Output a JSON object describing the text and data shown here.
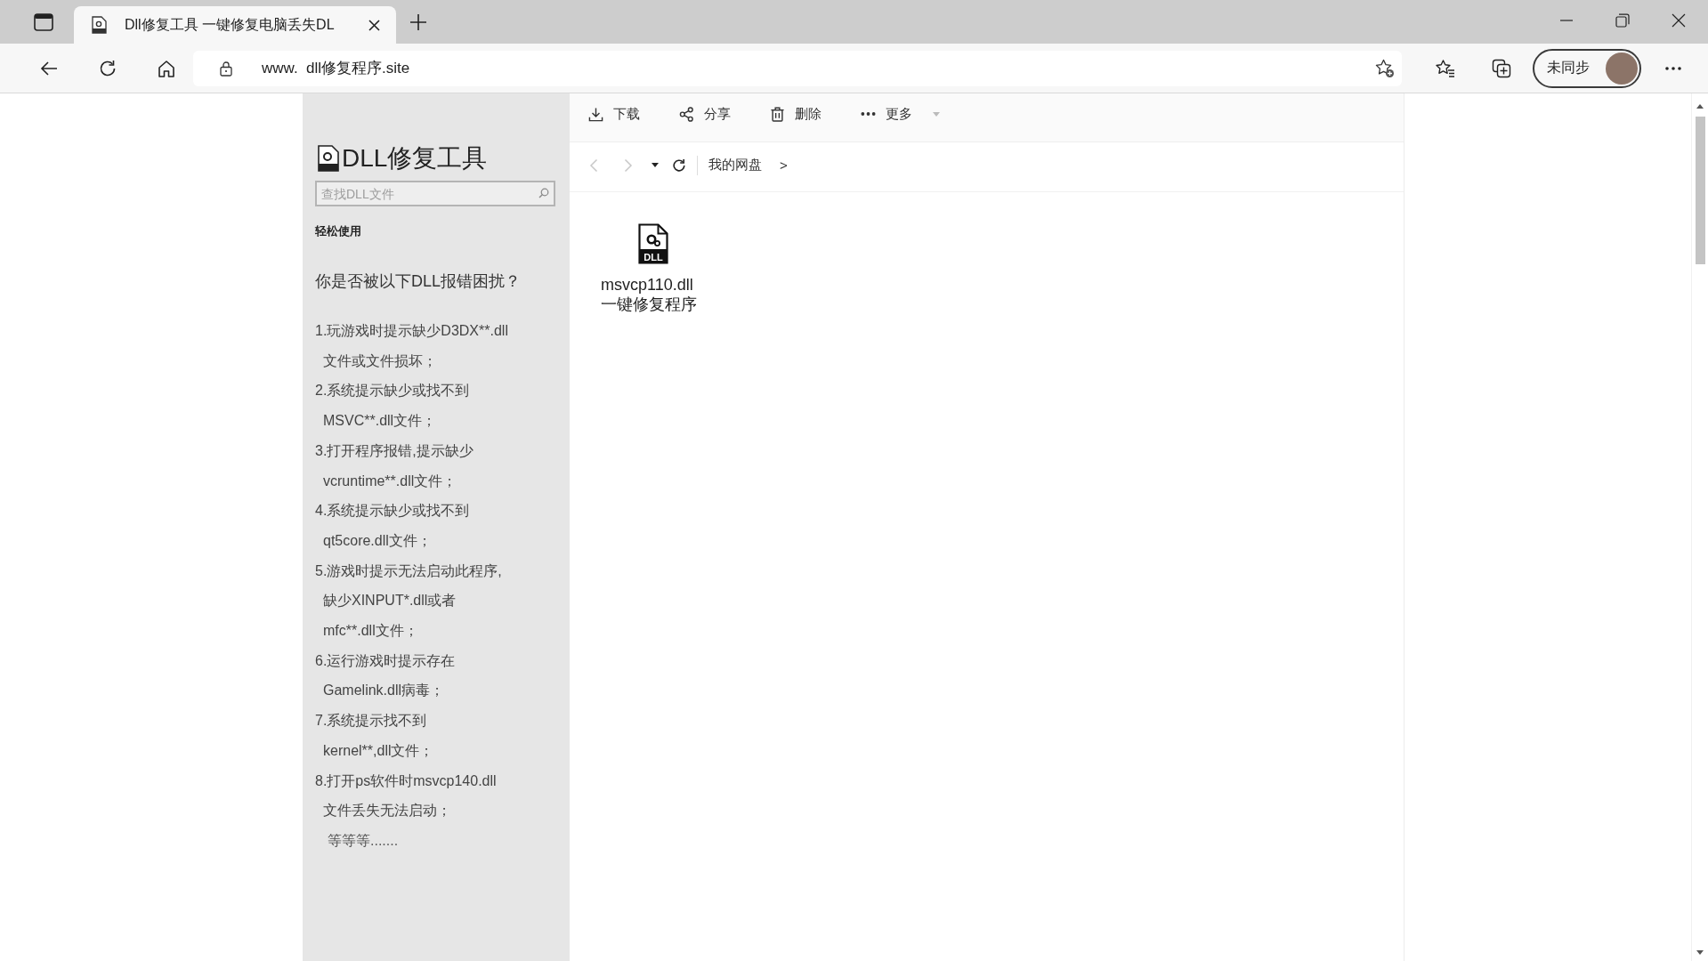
{
  "browser": {
    "tabs": [
      {
        "title": "Dll修复工具 一键修复电脑丢失DL",
        "selected": true
      }
    ],
    "address": "www.  dll修复程序.site",
    "profile": {
      "label": "未同步"
    }
  },
  "sidebar": {
    "title": "DLL修复工具",
    "search": {
      "placeholder": "查找DLL文件"
    },
    "section": "轻松使用",
    "question": "你是否被以下DLL报错困扰？",
    "issues": [
      {
        "lines": [
          "1.玩游戏时提示缺少D3DX**.dll",
          "文件或文件损坏；"
        ]
      },
      {
        "lines": [
          "2.系统提示缺少或找不到",
          "MSVC**.dll文件；"
        ]
      },
      {
        "lines": [
          "3.打开程序报错,提示缺少",
          "vcruntime**.dll文件；"
        ]
      },
      {
        "lines": [
          "4.系统提示缺少或找不到",
          "qt5core.dll文件；"
        ]
      },
      {
        "lines": [
          "5.游戏时提示无法启动此程序,",
          "缺少XINPUT*.dll或者",
          "mfc**.dll文件；"
        ]
      },
      {
        "lines": [
          "6.运行游戏时提示存在",
          "Gamelink.dll病毒；"
        ]
      },
      {
        "lines": [
          "7.系统提示找不到",
          "kernel**,dll文件；"
        ]
      },
      {
        "lines": [
          "8.打开ps软件时msvcp140.dll",
          "文件丢失无法启动；"
        ]
      }
    ],
    "footer": "等等等......."
  },
  "toolbar": {
    "actions": [
      {
        "kind": "download",
        "label": "下载"
      },
      {
        "kind": "share",
        "label": "分享"
      },
      {
        "kind": "delete",
        "label": "删除"
      },
      {
        "kind": "more",
        "label": "更多"
      }
    ]
  },
  "breadcrumb": {
    "nav": [
      {
        "kind": "back",
        "disabled": true
      },
      {
        "kind": "forward",
        "disabled": true
      }
    ],
    "path": [
      {
        "label": "我的网盘",
        "separator": ">"
      }
    ]
  },
  "files": [
    {
      "name": "msvcp110.dll一键修复程序",
      "badge": "DLL"
    }
  ]
}
